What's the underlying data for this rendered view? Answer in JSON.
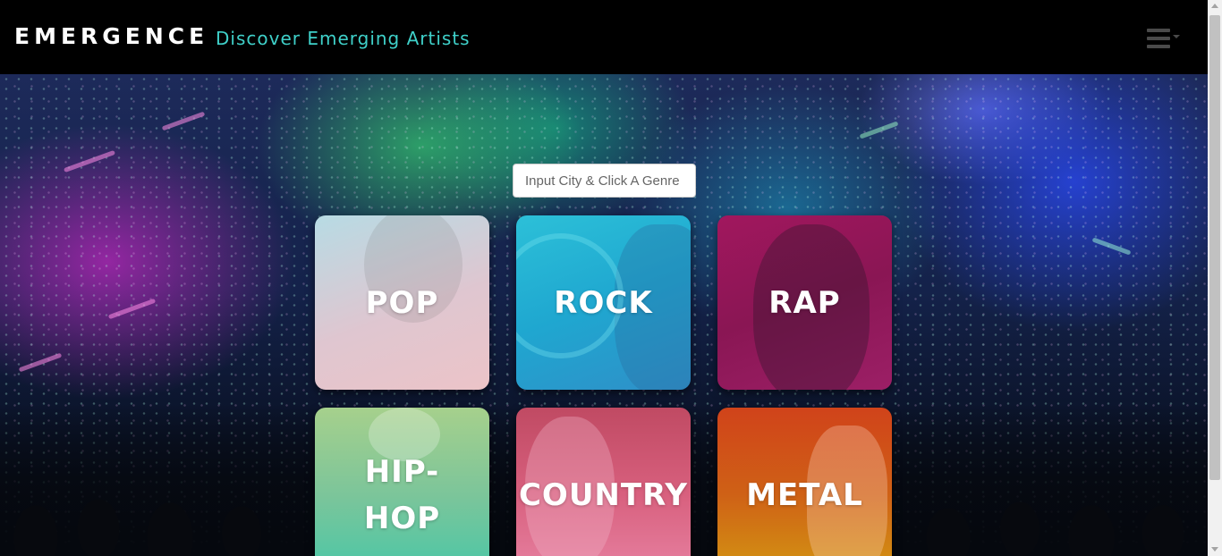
{
  "navbar": {
    "brand": "EMERGENCE",
    "tagline": "Discover Emerging Artists",
    "menu_icon": "hamburger-menu-icon"
  },
  "search": {
    "placeholder": "Input City & Click A Genre",
    "value": ""
  },
  "genres": [
    {
      "label": "POP",
      "color": "#dcc8d2"
    },
    {
      "label": "ROCK",
      "color": "#22b2d4"
    },
    {
      "label": "RAP",
      "color": "#92185a"
    },
    {
      "label": "HIP-\nHOP",
      "color": "#86c99a"
    },
    {
      "label": "COUNTRY",
      "color": "#d25f7c"
    },
    {
      "label": "METAL",
      "color": "#cf5e17"
    }
  ],
  "colors": {
    "navbar_bg": "#000000",
    "brand": "#ffffff",
    "tagline": "#3fd0c9"
  }
}
